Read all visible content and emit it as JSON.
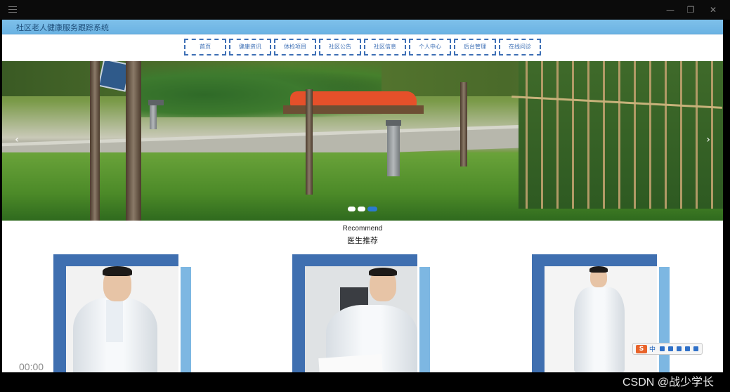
{
  "window": {
    "minimize_glyph": "—",
    "restore_glyph": "❐",
    "close_glyph": "✕"
  },
  "app": {
    "title": "社区老人健康服务跟踪系统"
  },
  "nav": {
    "items": [
      {
        "label": "首页"
      },
      {
        "label": "健康资讯"
      },
      {
        "label": "体检项目"
      },
      {
        "label": "社区公告"
      },
      {
        "label": "社区信息"
      },
      {
        "label": "个人中心"
      },
      {
        "label": "后台管理"
      },
      {
        "label": "在线问诊"
      }
    ]
  },
  "carousel": {
    "prev_glyph": "‹",
    "next_glyph": "›",
    "slide_count": 3,
    "active_index": 2
  },
  "recommend": {
    "title_en": "Recommend",
    "title_cn": "医生推荐"
  },
  "ime": {
    "logo": "S",
    "mode": "中"
  },
  "video": {
    "timecode": "00:00"
  },
  "watermark": "CSDN @战少学长",
  "colors": {
    "header": "#6bb3e3",
    "nav_border": "#3d6fb5",
    "card_dark": "#3f6fb0",
    "card_light": "#7db7e2",
    "dot_active": "#2b7ad0"
  }
}
